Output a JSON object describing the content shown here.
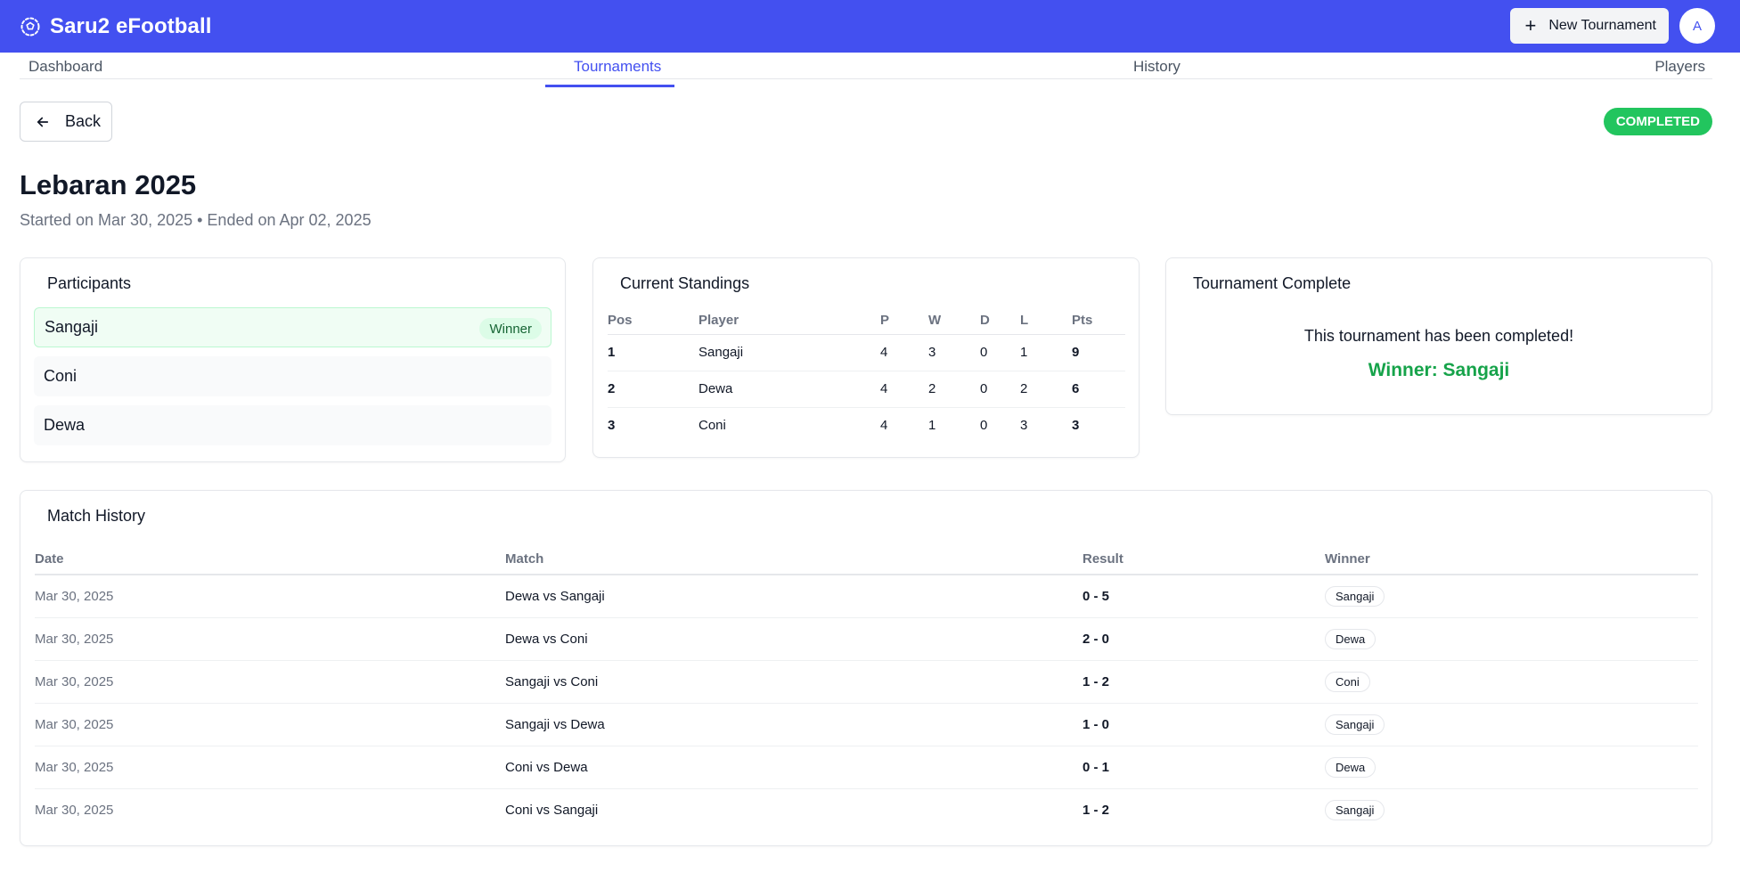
{
  "app": {
    "title": "Saru2 eFootball",
    "new_button": "New Tournament",
    "avatar": "A",
    "logo_icon": "soccer-ball-icon"
  },
  "tabs": [
    "Dashboard",
    "Tournaments",
    "History",
    "Players"
  ],
  "back_label": "Back",
  "status": "COMPLETED",
  "tournament": {
    "name": "Lebaran 2025",
    "subtitle": "Started on Mar 30, 2025 • Ended on Apr 02, 2025"
  },
  "participants": {
    "title": "Participants",
    "winner_badge": "Winner",
    "items": [
      "Sangaji",
      "Coni",
      "Dewa"
    ]
  },
  "standings": {
    "title": "Current Standings",
    "headers": [
      "Pos",
      "Player",
      "P",
      "W",
      "D",
      "L",
      "Pts"
    ],
    "rows": [
      [
        "1",
        "Sangaji",
        "4",
        "3",
        "0",
        "1",
        "9"
      ],
      [
        "2",
        "Dewa",
        "4",
        "2",
        "0",
        "2",
        "6"
      ],
      [
        "3",
        "Coni",
        "4",
        "1",
        "0",
        "3",
        "3"
      ]
    ]
  },
  "complete": {
    "title": "Tournament Complete",
    "message": "This tournament has been completed!",
    "winner_text": "Winner: Sangaji"
  },
  "match_history": {
    "title": "Match History",
    "headers": [
      "Date",
      "Match",
      "Result",
      "Winner"
    ],
    "rows": [
      [
        "Mar 30, 2025",
        "Dewa vs Sangaji",
        "0 - 5",
        "Sangaji"
      ],
      [
        "Mar 30, 2025",
        "Dewa vs Coni",
        "2 - 0",
        "Dewa"
      ],
      [
        "Mar 30, 2025",
        "Sangaji vs Coni",
        "1 - 2",
        "Coni"
      ],
      [
        "Mar 30, 2025",
        "Sangaji vs Dewa",
        "1 - 0",
        "Sangaji"
      ],
      [
        "Mar 30, 2025",
        "Coni vs Dewa",
        "0 - 1",
        "Dewa"
      ],
      [
        "Mar 30, 2025",
        "Coni vs Sangaji",
        "1 - 2",
        "Sangaji"
      ]
    ]
  },
  "colors": {
    "brand": "#4350f0",
    "success": "#22c55e",
    "winner_text": "#16a34a"
  }
}
